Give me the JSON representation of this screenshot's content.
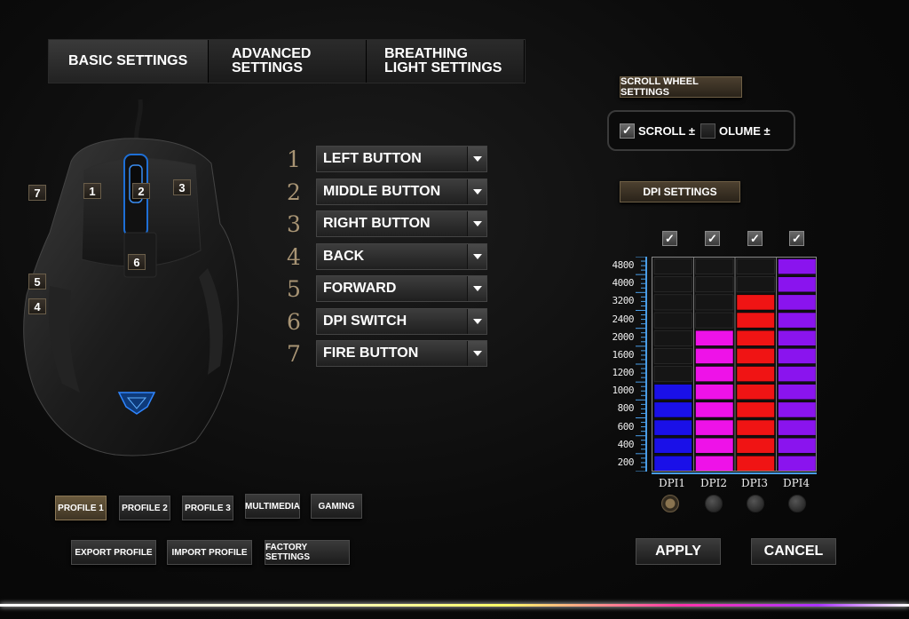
{
  "tabs": [
    {
      "label": "BASIC SETTINGS"
    },
    {
      "label": "ADVANCED\nSETTINGS"
    },
    {
      "label": "BREATHING\nLIGHT SETTINGS"
    }
  ],
  "mouse_badges": [
    "1",
    "2",
    "3",
    "4",
    "5",
    "6",
    "7"
  ],
  "button_map": [
    {
      "num": "1",
      "label": "LEFT BUTTON"
    },
    {
      "num": "2",
      "label": "MIDDLE BUTTON"
    },
    {
      "num": "3",
      "label": "RIGHT BUTTON"
    },
    {
      "num": "4",
      "label": "BACK"
    },
    {
      "num": "5",
      "label": "FORWARD"
    },
    {
      "num": "6",
      "label": "DPI SWITCH"
    },
    {
      "num": "7",
      "label": "FIRE BUTTON"
    }
  ],
  "scroll": {
    "header": "SCROLL WHEEL SETTINGS",
    "opt1": "SCROLL ±",
    "opt1_checked": true,
    "opt2": "OLUME ±",
    "opt2_checked": false
  },
  "dpi": {
    "header": "DPI SETTINGS",
    "enabled": [
      true,
      true,
      true,
      true
    ],
    "tick_labels": [
      "4800",
      "4000",
      "3200",
      "2400",
      "2000",
      "1600",
      "1200",
      "1000",
      "800",
      "600",
      "400",
      "200"
    ],
    "levels": [
      {
        "label": "DPI1",
        "value": 1000,
        "color": "#1a10e8"
      },
      {
        "label": "DPI2",
        "value": 2000,
        "color": "#ee12e8"
      },
      {
        "label": "DPI3",
        "value": 3200,
        "color": "#f01414"
      },
      {
        "label": "DPI4",
        "value": 4800,
        "color": "#8a14ee"
      }
    ],
    "selected": 0
  },
  "profiles": [
    {
      "label": "PROFILE 1",
      "active": true
    },
    {
      "label": "PROFILE 2",
      "active": false
    },
    {
      "label": "PROFILE 3",
      "active": false
    },
    {
      "label": "MULTIMEDIA",
      "active": false
    },
    {
      "label": "GAMING",
      "active": false
    }
  ],
  "profile_actions": [
    "EXPORT PROFILE",
    "IMPORT PROFILE",
    "FACTORY SETTINGS"
  ],
  "actions": {
    "apply": "APPLY",
    "cancel": "CANCEL"
  }
}
